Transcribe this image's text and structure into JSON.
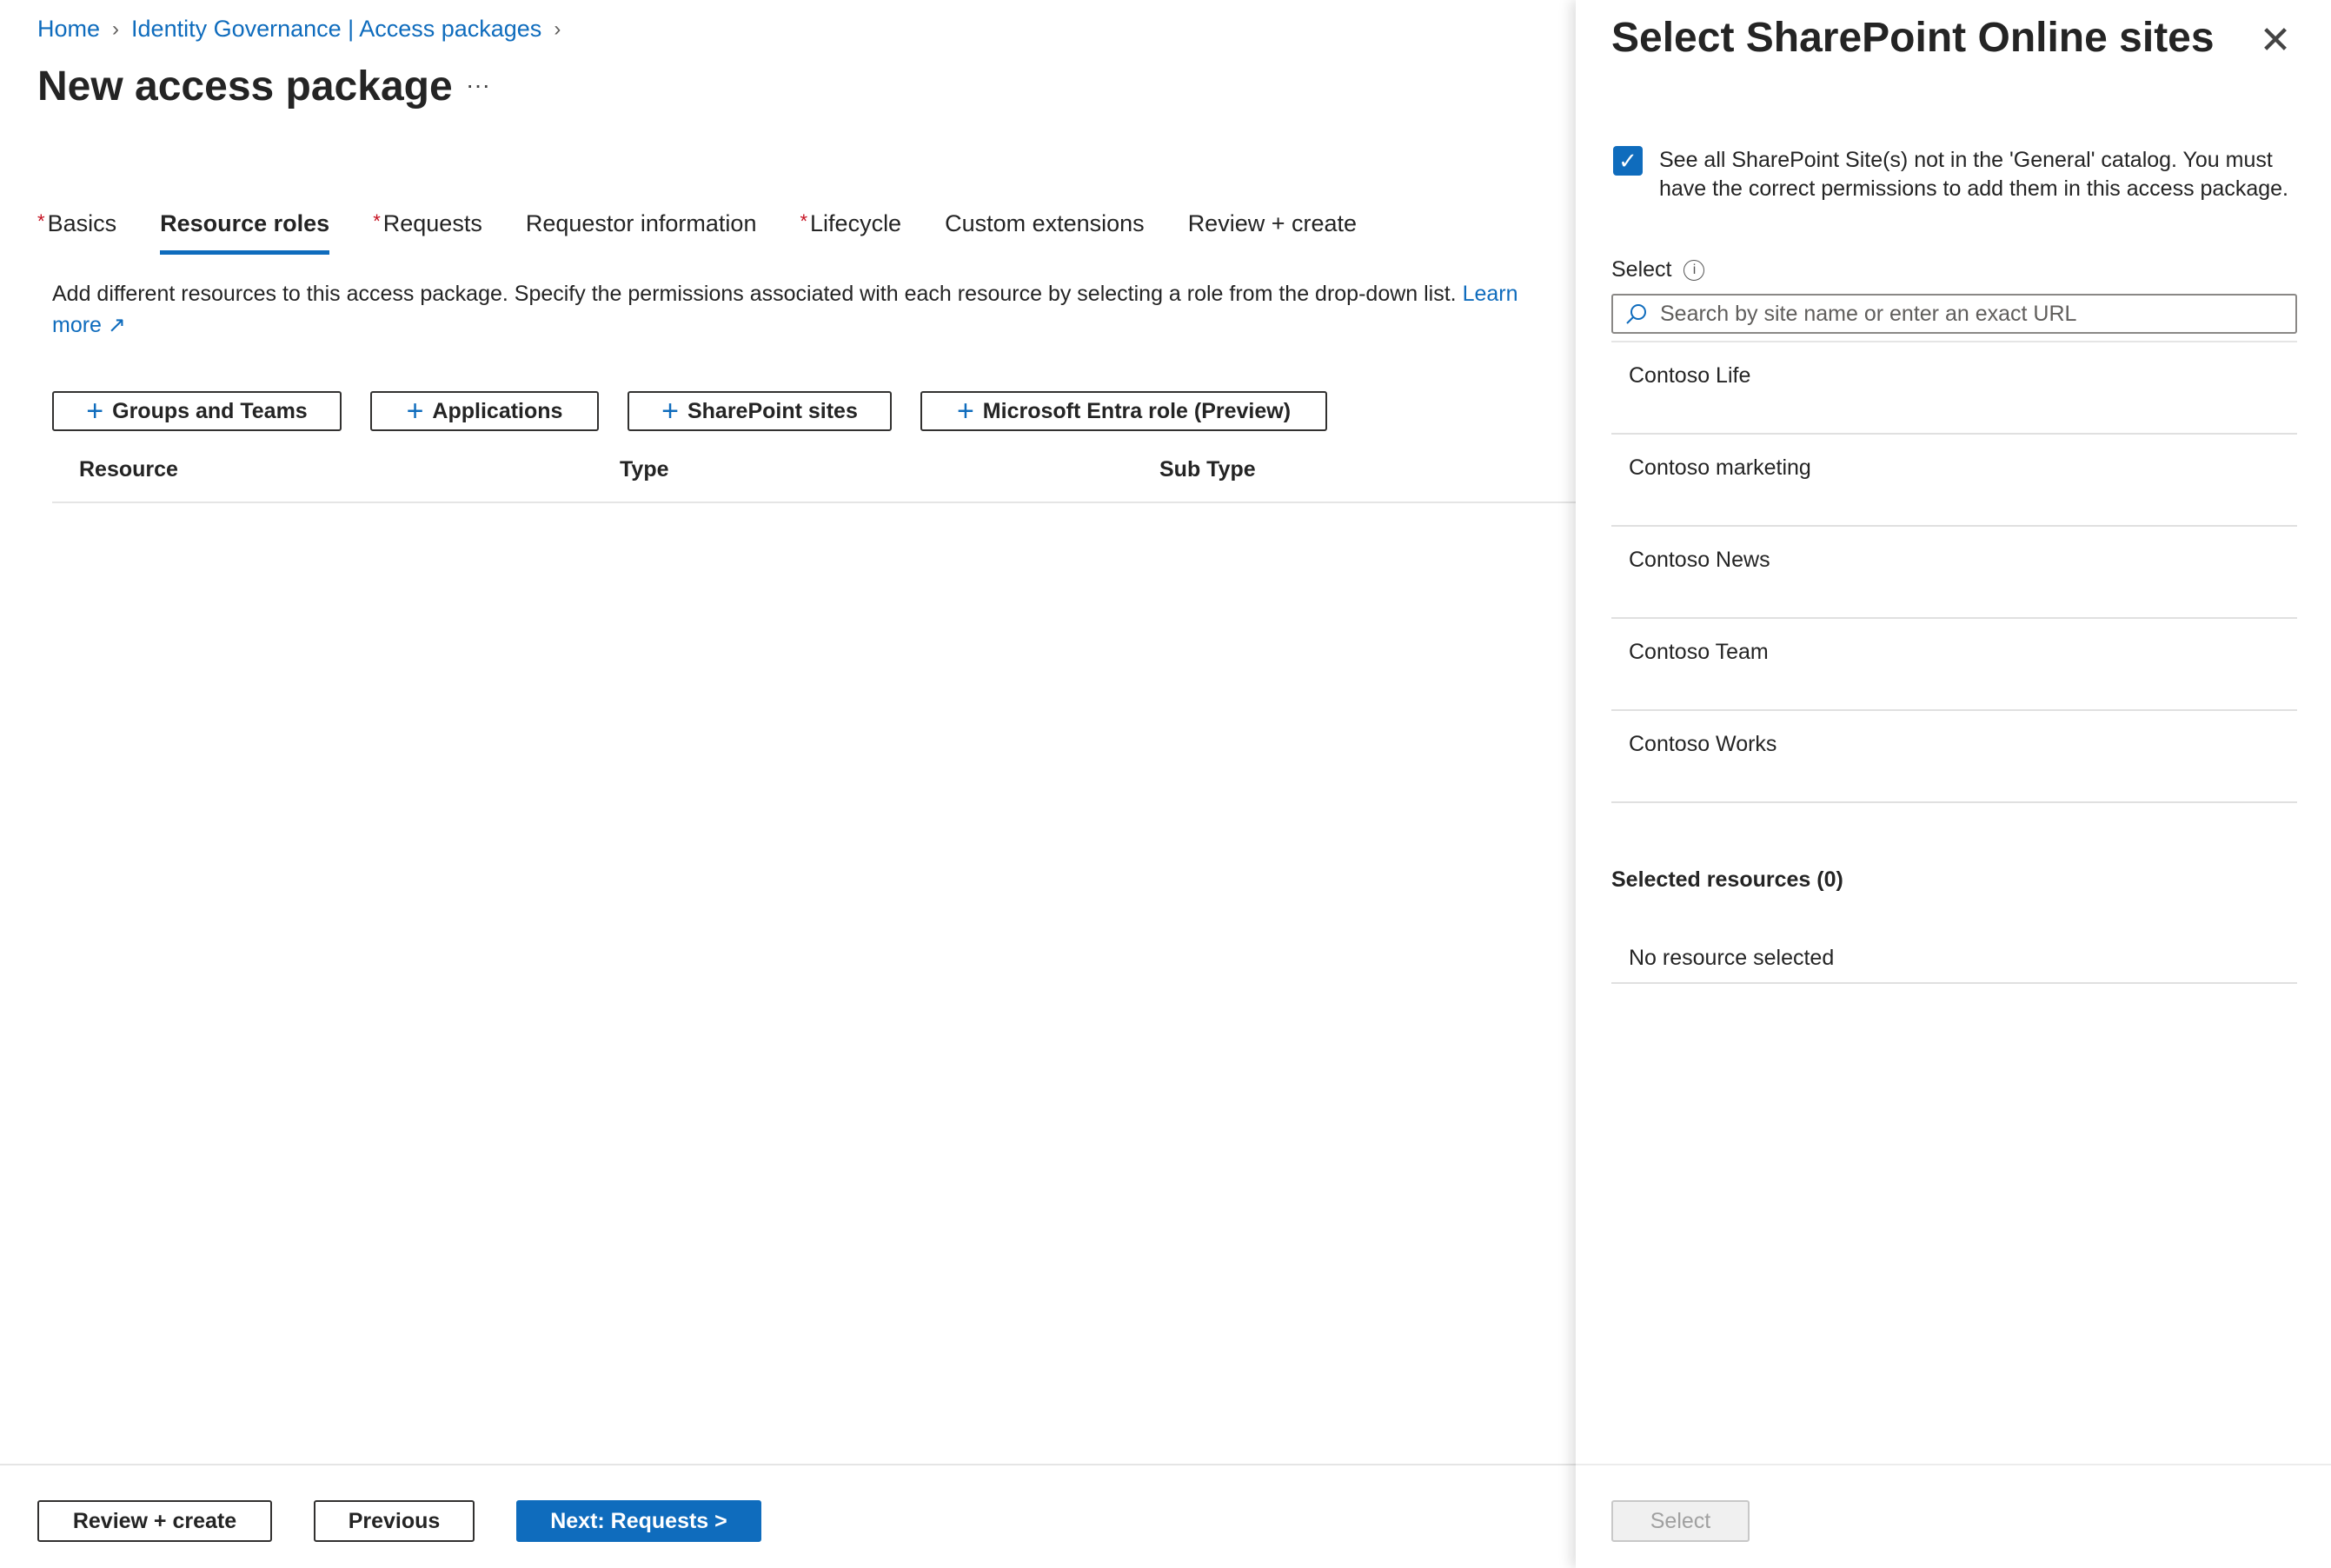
{
  "breadcrumb": {
    "items": [
      "Home",
      "Identity Governance | Access packages"
    ]
  },
  "page": {
    "title": "New access package",
    "more": "···"
  },
  "tabs": [
    {
      "label": "Basics",
      "required": "*"
    },
    {
      "label": "Resource roles"
    },
    {
      "label": "Requests",
      "required": "*"
    },
    {
      "label": "Requestor information"
    },
    {
      "label": "Lifecycle",
      "required": "*"
    },
    {
      "label": "Custom extensions"
    },
    {
      "label": "Review + create"
    }
  ],
  "description": {
    "text": "Add different resources to this access package. Specify the permissions associated with each resource by selecting a role from the drop-down list. ",
    "link": "Learn more"
  },
  "add_buttons": [
    "Groups and Teams",
    "Applications",
    "SharePoint sites",
    "Microsoft Entra role (Preview)"
  ],
  "table": {
    "columns": [
      "Resource",
      "Type",
      "Sub Type"
    ]
  },
  "footer": {
    "review": "Review + create",
    "previous": "Previous",
    "next": "Next: Requests >"
  },
  "panel": {
    "title": "Select SharePoint Online sites",
    "checkbox_label": "See all SharePoint Site(s) not in the 'General' catalog. You must have the correct permissions to add them in this access package.",
    "checkbox_checked": true,
    "select_label": "Select",
    "search_placeholder": "Search by site name or enter an exact URL",
    "sites": [
      "Contoso Life",
      "Contoso marketing",
      "Contoso News",
      "Contoso Team",
      "Contoso Works"
    ],
    "selected_heading": "Selected resources (0)",
    "empty_text": "No resource selected",
    "select_button": "Select"
  },
  "colors": {
    "accent": "#0f6cbd",
    "required": "#c50f1f"
  }
}
